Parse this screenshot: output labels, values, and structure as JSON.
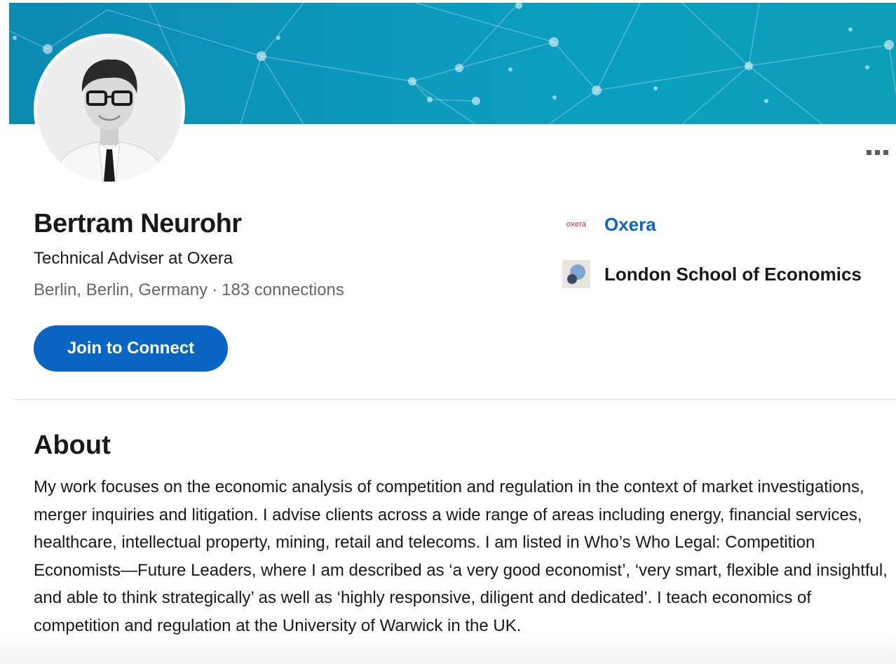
{
  "profile": {
    "name": "Bertram Neurohr",
    "headline": "Technical Adviser at Oxera",
    "location": "Berlin, Berlin, Germany",
    "separator": "·",
    "connections": "183 connections",
    "join_button": "Join to Connect"
  },
  "organizations": [
    {
      "name": "Oxera",
      "logo_text": "oxera",
      "logo_icon": "oxera-logo-icon"
    },
    {
      "name": "London School of Economics",
      "logo_icon": "lse-logo-icon"
    }
  ],
  "about": {
    "title": "About",
    "text": "My work focuses on the economic analysis of competition and regulation in the context of market investigations, merger inquiries and litigation. I advise clients across a wide range of areas including energy, financial services, healthcare, intellectual property, mining, retail and telecoms. I am listed in Who’s Who Legal: Competition Economists—Future Leaders, where I am described as ‘a very good economist’, ‘very smart, flexible and insightful, and able to think strategically’ as well as ‘highly responsive, diligent and dedicated’. I teach economics of competition and regulation at the University of Warwick in the UK."
  },
  "colors": {
    "accent": "#0a66c2",
    "banner": "#0b98bd",
    "oxera_brand": "#c0273a"
  },
  "icons": {
    "more": "more-options-icon"
  }
}
